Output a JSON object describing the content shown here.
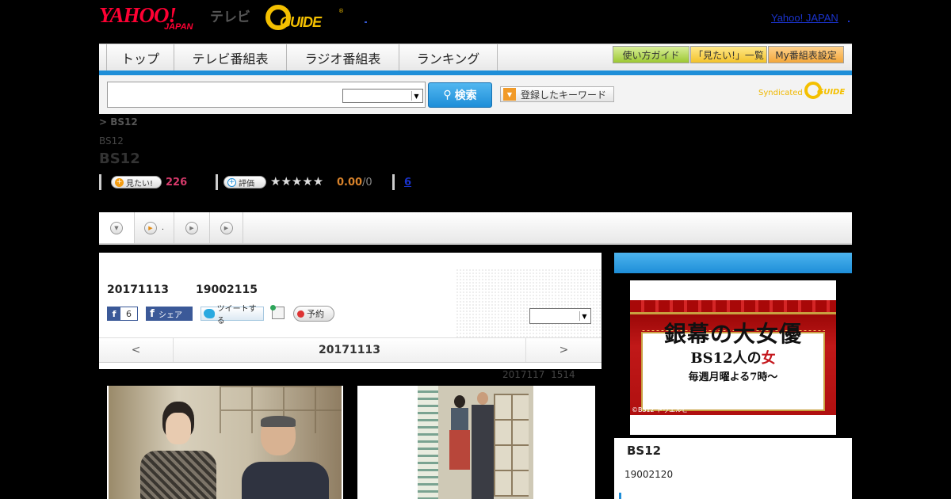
{
  "header": {
    "yahoo_logo": "YAHOO!",
    "yahoo_japan": "JAPAN",
    "tv_label": "テレビ",
    "gguide_logo": "GUIDE",
    "gguide_reg": "®",
    "yahoo_japan_link": "Yahoo! JAPAN"
  },
  "nav": {
    "tabs": [
      "トップ",
      "テレビ番組表",
      "ラジオ番組表",
      "ランキング"
    ],
    "buttons": [
      "使い方ガイド",
      "「見たい!」一覧",
      "My番組表設定"
    ]
  },
  "search": {
    "input_value": "",
    "select_value": "",
    "button_label": "検索",
    "keyword_button": "登録したキーワード",
    "syndicated": "Syndicated",
    "syndicated_logo": "GUIDE"
  },
  "title_area": {
    "breadcrumb": "> BS12",
    "channel_small": "BS12",
    "channel_big": "BS12",
    "want_label": "見たい!",
    "want_count": "226",
    "rate_label": "評価",
    "stars": "★★★★★",
    "rating": "0.00",
    "rating_count": "/0",
    "comment_count": "6"
  },
  "tabstrip": {
    "item2_label": "."
  },
  "program": {
    "date": "20171113",
    "id": "19002115",
    "fb_count": "6",
    "fb_share": "シェア",
    "tweet": "ツイートする",
    "reserve": "予約",
    "select_value": "",
    "prev": "<",
    "next": ">",
    "nav_date": "20171113",
    "updated": "2017117  1514"
  },
  "sidebar": {
    "banner_title": "銀幕の大女優",
    "banner_sub_a": "BS12人の",
    "banner_sub_b": "女",
    "banner_schedule": "毎週月曜よる7時～",
    "banner_copyright": "©BS12 トゥエルビ",
    "title": "BS12",
    "id": "19002120"
  },
  "colors": {
    "accent_blue": "#1e8ed8",
    "yahoo_red": "#ff0033",
    "gguide_yellow": "#f4c000",
    "want_pink": "#d63a6b",
    "rating_orange": "#d9832b"
  }
}
